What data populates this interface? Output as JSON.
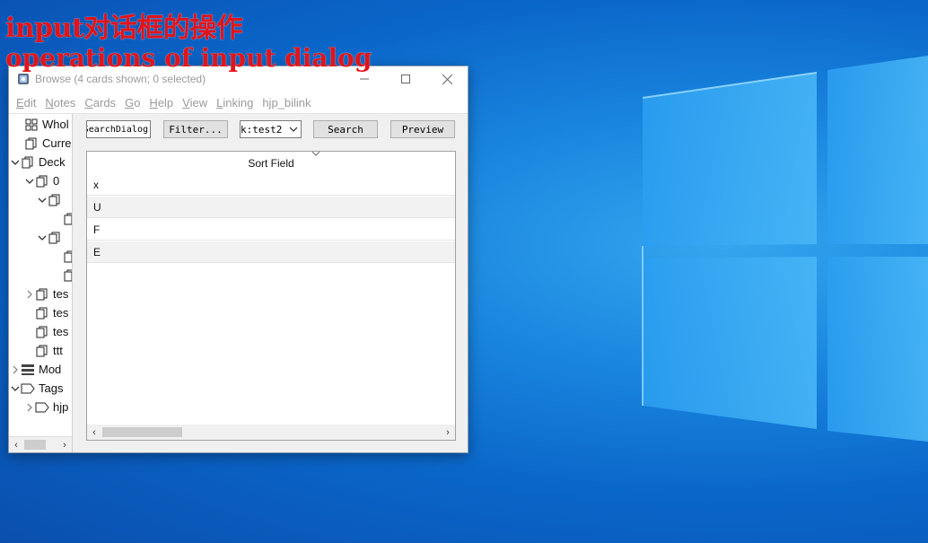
{
  "captions": {
    "line1": "input对话框的操作",
    "line2": "operations of input dialog"
  },
  "window": {
    "title": "Browse (4 cards shown; 0 selected)",
    "icon": "app-icon",
    "controls": [
      "minimize-icon",
      "maximize-icon",
      "close-icon"
    ]
  },
  "menu": {
    "items": [
      {
        "first": "E",
        "rest": "dit"
      },
      {
        "first": "N",
        "rest": "otes"
      },
      {
        "first": "C",
        "rest": "ards"
      },
      {
        "first": "G",
        "rest": "o"
      },
      {
        "first": "H",
        "rest": "elp"
      },
      {
        "first": "V",
        "rest": "iew"
      },
      {
        "first": "L",
        "rest": "inking"
      },
      {
        "first": "",
        "rest": "hjp_bilink"
      }
    ]
  },
  "sidebar": {
    "items": [
      {
        "label": "Whol",
        "icon": "whole-collection-icon"
      },
      {
        "label": "Curre",
        "icon": "cards-icon"
      },
      {
        "label": "Deck",
        "icon": "cards-icon"
      },
      {
        "label": "0",
        "icon": "deck-icon"
      },
      {
        "label": "",
        "icon": "deck-icon"
      },
      {
        "label": "",
        "icon": "deck-icon"
      },
      {
        "label": "",
        "icon": "deck-icon"
      },
      {
        "label": "",
        "icon": "deck-icon"
      },
      {
        "label": "",
        "icon": "deck-icon"
      },
      {
        "label": "tes",
        "icon": "deck-icon"
      },
      {
        "label": "tes",
        "icon": "deck-icon"
      },
      {
        "label": "tes",
        "icon": "deck-icon"
      },
      {
        "label": "ttt",
        "icon": "deck-icon"
      },
      {
        "label": "Mod",
        "icon": "note-types-icon"
      },
      {
        "label": "Tags",
        "icon": "tag-icon"
      },
      {
        "label": "hjp",
        "icon": "tag-icon"
      }
    ]
  },
  "toolbar": {
    "search_dialog_value": "SearchDialog",
    "filter_label": "Filter...",
    "deck_select_value": "k:test2",
    "search_label": "Search",
    "preview_label": "Preview"
  },
  "table": {
    "column_header": "Sort Field",
    "rows": [
      "x",
      "U",
      "F",
      "E"
    ]
  },
  "colors": {
    "caption_red": "#e0141b",
    "desktop_blue": "#0a66c9"
  }
}
